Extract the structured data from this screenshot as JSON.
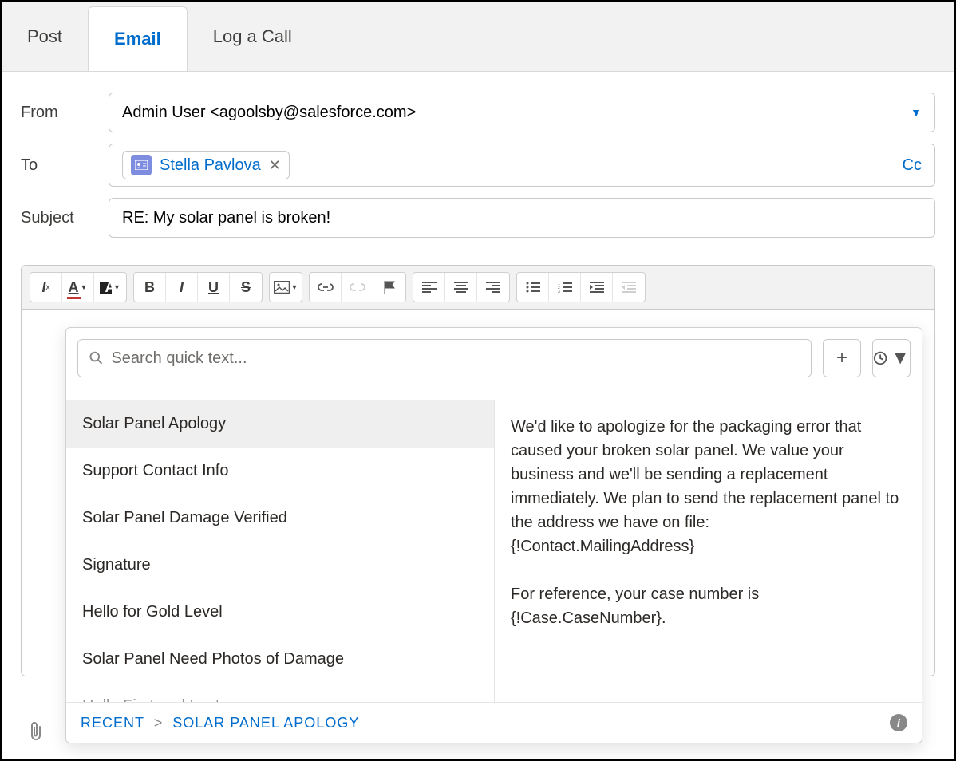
{
  "tabs": [
    {
      "label": "Post",
      "active": false
    },
    {
      "label": "Email",
      "active": true
    },
    {
      "label": "Log a Call",
      "active": false
    }
  ],
  "form": {
    "from_label": "From",
    "from_value": "Admin User <agoolsby@salesforce.com>",
    "to_label": "To",
    "to_pill": "Stella Pavlova",
    "cc_label": "Cc",
    "subject_label": "Subject",
    "subject_value": "RE: My solar panel is broken!"
  },
  "quicktext": {
    "search_placeholder": "Search quick text...",
    "items": [
      "Solar Panel Apology",
      "Support Contact Info",
      "Solar Panel Damage Verified",
      "Signature",
      "Hello for Gold Level",
      "Solar Panel Need Photos of Damage",
      "Hello First and Last"
    ],
    "selected_index": 0,
    "preview": "We'd like to apologize for the packaging error that caused your broken solar panel. We value your business and we'll be sending a replacement immediately. We plan to send the replacement panel to the address we have on file:\n{!Contact.MailingAddress}\n\nFor reference, your case number is {!Case.CaseNumber}.",
    "breadcrumb": {
      "root": "RECENT",
      "current": "SOLAR PANEL APOLOGY",
      "sep": ">"
    }
  }
}
